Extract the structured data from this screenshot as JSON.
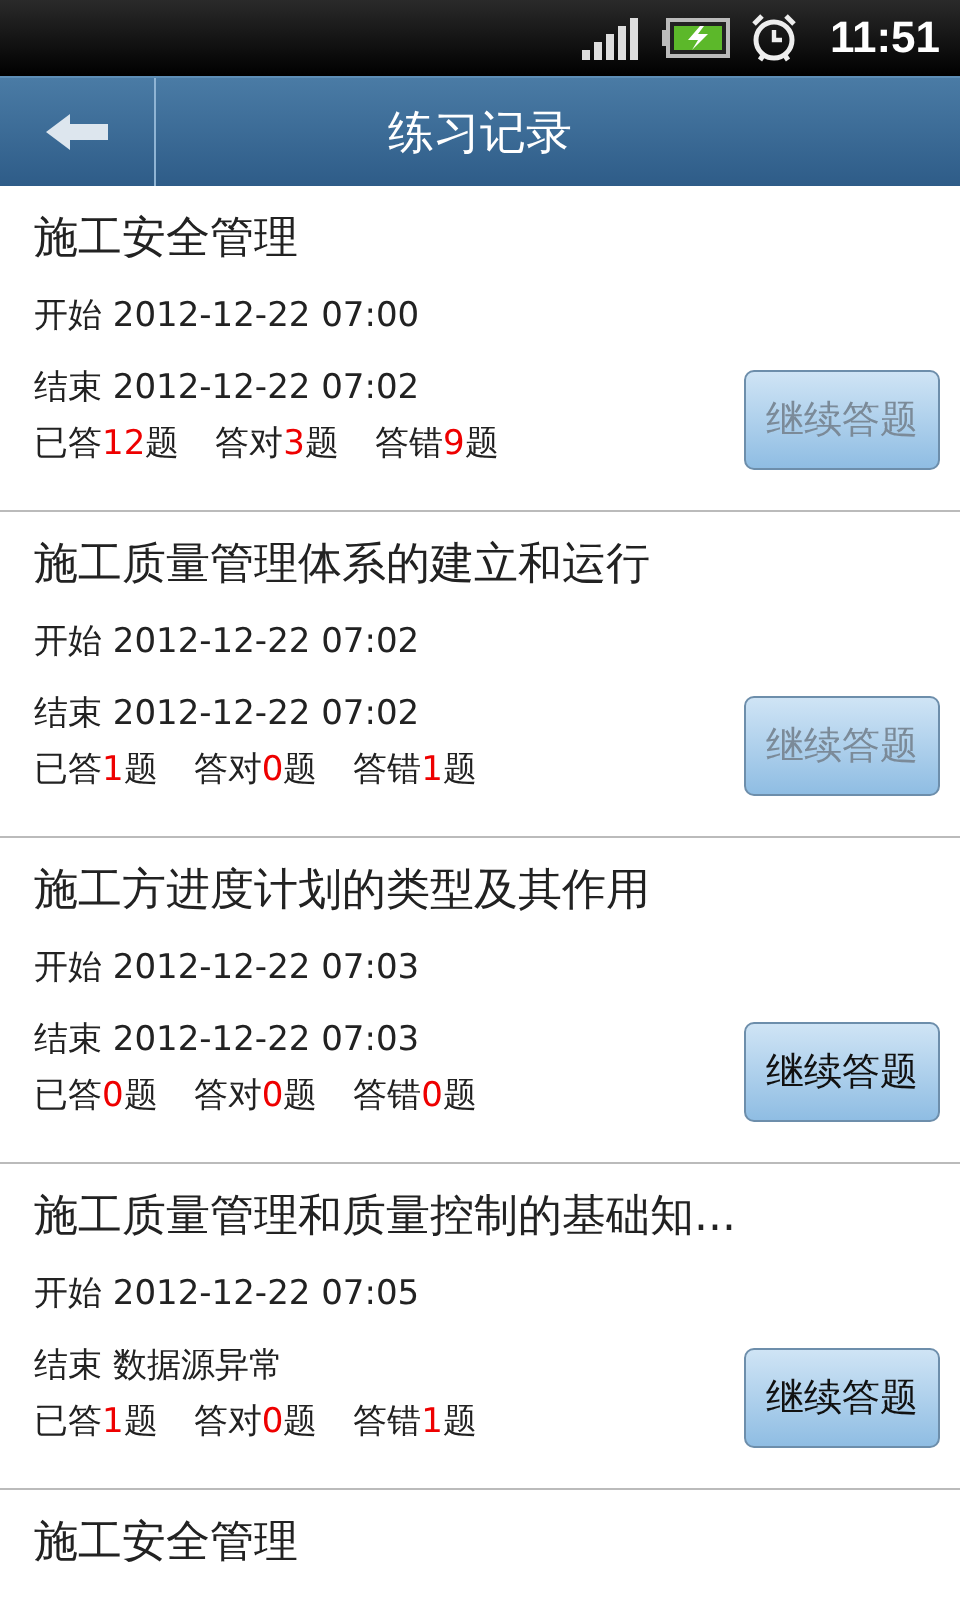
{
  "status_bar": {
    "time": "11:51"
  },
  "header": {
    "title": "练习记录"
  },
  "records": [
    {
      "title": "施工安全管理",
      "start": "开始 2012-12-22 07:00",
      "end": "结束 2012-12-22 07:02",
      "stats": [
        {
          "label": "已答",
          "count": "12",
          "unit": "题"
        },
        {
          "label": "答对",
          "count": "3",
          "unit": "题"
        },
        {
          "label": "答错",
          "count": "9",
          "unit": "题"
        }
      ],
      "button": {
        "label": "继续答题",
        "disabled": true
      }
    },
    {
      "title": "施工质量管理体系的建立和运行",
      "start": "开始 2012-12-22 07:02",
      "end": "结束 2012-12-22 07:02",
      "stats": [
        {
          "label": "已答",
          "count": "1",
          "unit": "题"
        },
        {
          "label": "答对",
          "count": "0",
          "unit": "题"
        },
        {
          "label": "答错",
          "count": "1",
          "unit": "题"
        }
      ],
      "button": {
        "label": "继续答题",
        "disabled": true
      }
    },
    {
      "title": "施工方进度计划的类型及其作用",
      "start": "开始 2012-12-22 07:03",
      "end": "结束 2012-12-22 07:03",
      "stats": [
        {
          "label": "已答",
          "count": "0",
          "unit": "题"
        },
        {
          "label": "答对",
          "count": "0",
          "unit": "题"
        },
        {
          "label": "答错",
          "count": "0",
          "unit": "题"
        }
      ],
      "button": {
        "label": "继续答题",
        "disabled": false
      }
    },
    {
      "title": "施工质量管理和质量控制的基础知...",
      "start": "开始 2012-12-22 07:05",
      "end": "结束 数据源异常",
      "stats": [
        {
          "label": "已答",
          "count": "1",
          "unit": "题"
        },
        {
          "label": "答对",
          "count": "0",
          "unit": "题"
        },
        {
          "label": "答错",
          "count": "1",
          "unit": "题"
        }
      ],
      "button": {
        "label": "继续答题",
        "disabled": false
      }
    },
    {
      "title": "施工安全管理"
    }
  ]
}
